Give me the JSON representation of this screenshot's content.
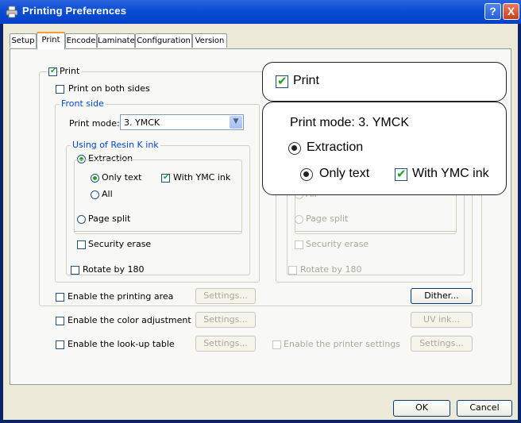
{
  "window": {
    "title": "Printing Preferences",
    "help_label": "?",
    "close_label": "X"
  },
  "tabs": [
    {
      "label": "Setup"
    },
    {
      "label": "Print"
    },
    {
      "label": "Encode"
    },
    {
      "label": "Laminate"
    },
    {
      "label": "Configuration"
    },
    {
      "label": "Version"
    }
  ],
  "print_panel": {
    "print_label": "Print",
    "both_sides_label": "Print on both sides",
    "front_side": {
      "title": "Front side",
      "print_mode_label": "Print mode:",
      "print_mode_value": "3. YMCK",
      "resin_group": {
        "title": "Using of Resin K ink",
        "extraction_label": "Extraction",
        "only_text_label": "Only text",
        "with_ymc_label": "With YMC ink",
        "all_label": "All",
        "page_split_label": "Page split",
        "security_erase_label": "Security erase"
      },
      "rotate_label": "Rotate by 180"
    },
    "back_side": {
      "all_label": "All",
      "page_split_label": "Page split",
      "security_erase_label": "Security erase",
      "rotate_label": "Rotate by 180"
    },
    "options": {
      "printing_area_label": "Enable the printing area",
      "color_adjustment_label": "Enable the color adjustment",
      "lookup_table_label": "Enable the look-up table",
      "printer_settings_label": "Enable the printer settings",
      "settings_label": "Settings...",
      "dither_label": "Dither...",
      "uv_ink_label": "UV ink..."
    }
  },
  "callout_print": {
    "print_label": "Print"
  },
  "callout_detail": {
    "print_mode_text": "Print mode:  3. YMCK",
    "extraction_label": "Extraction",
    "only_text_label": "Only text",
    "with_ymc_label": "With YMC ink"
  },
  "footer": {
    "ok_label": "OK",
    "cancel_label": "Cancel"
  },
  "colors": {
    "titlebar": "#0a4ed6",
    "check_green": "#21a121",
    "group_title_blue": "#0046d5",
    "dialog_bg": "#ece9d8"
  }
}
